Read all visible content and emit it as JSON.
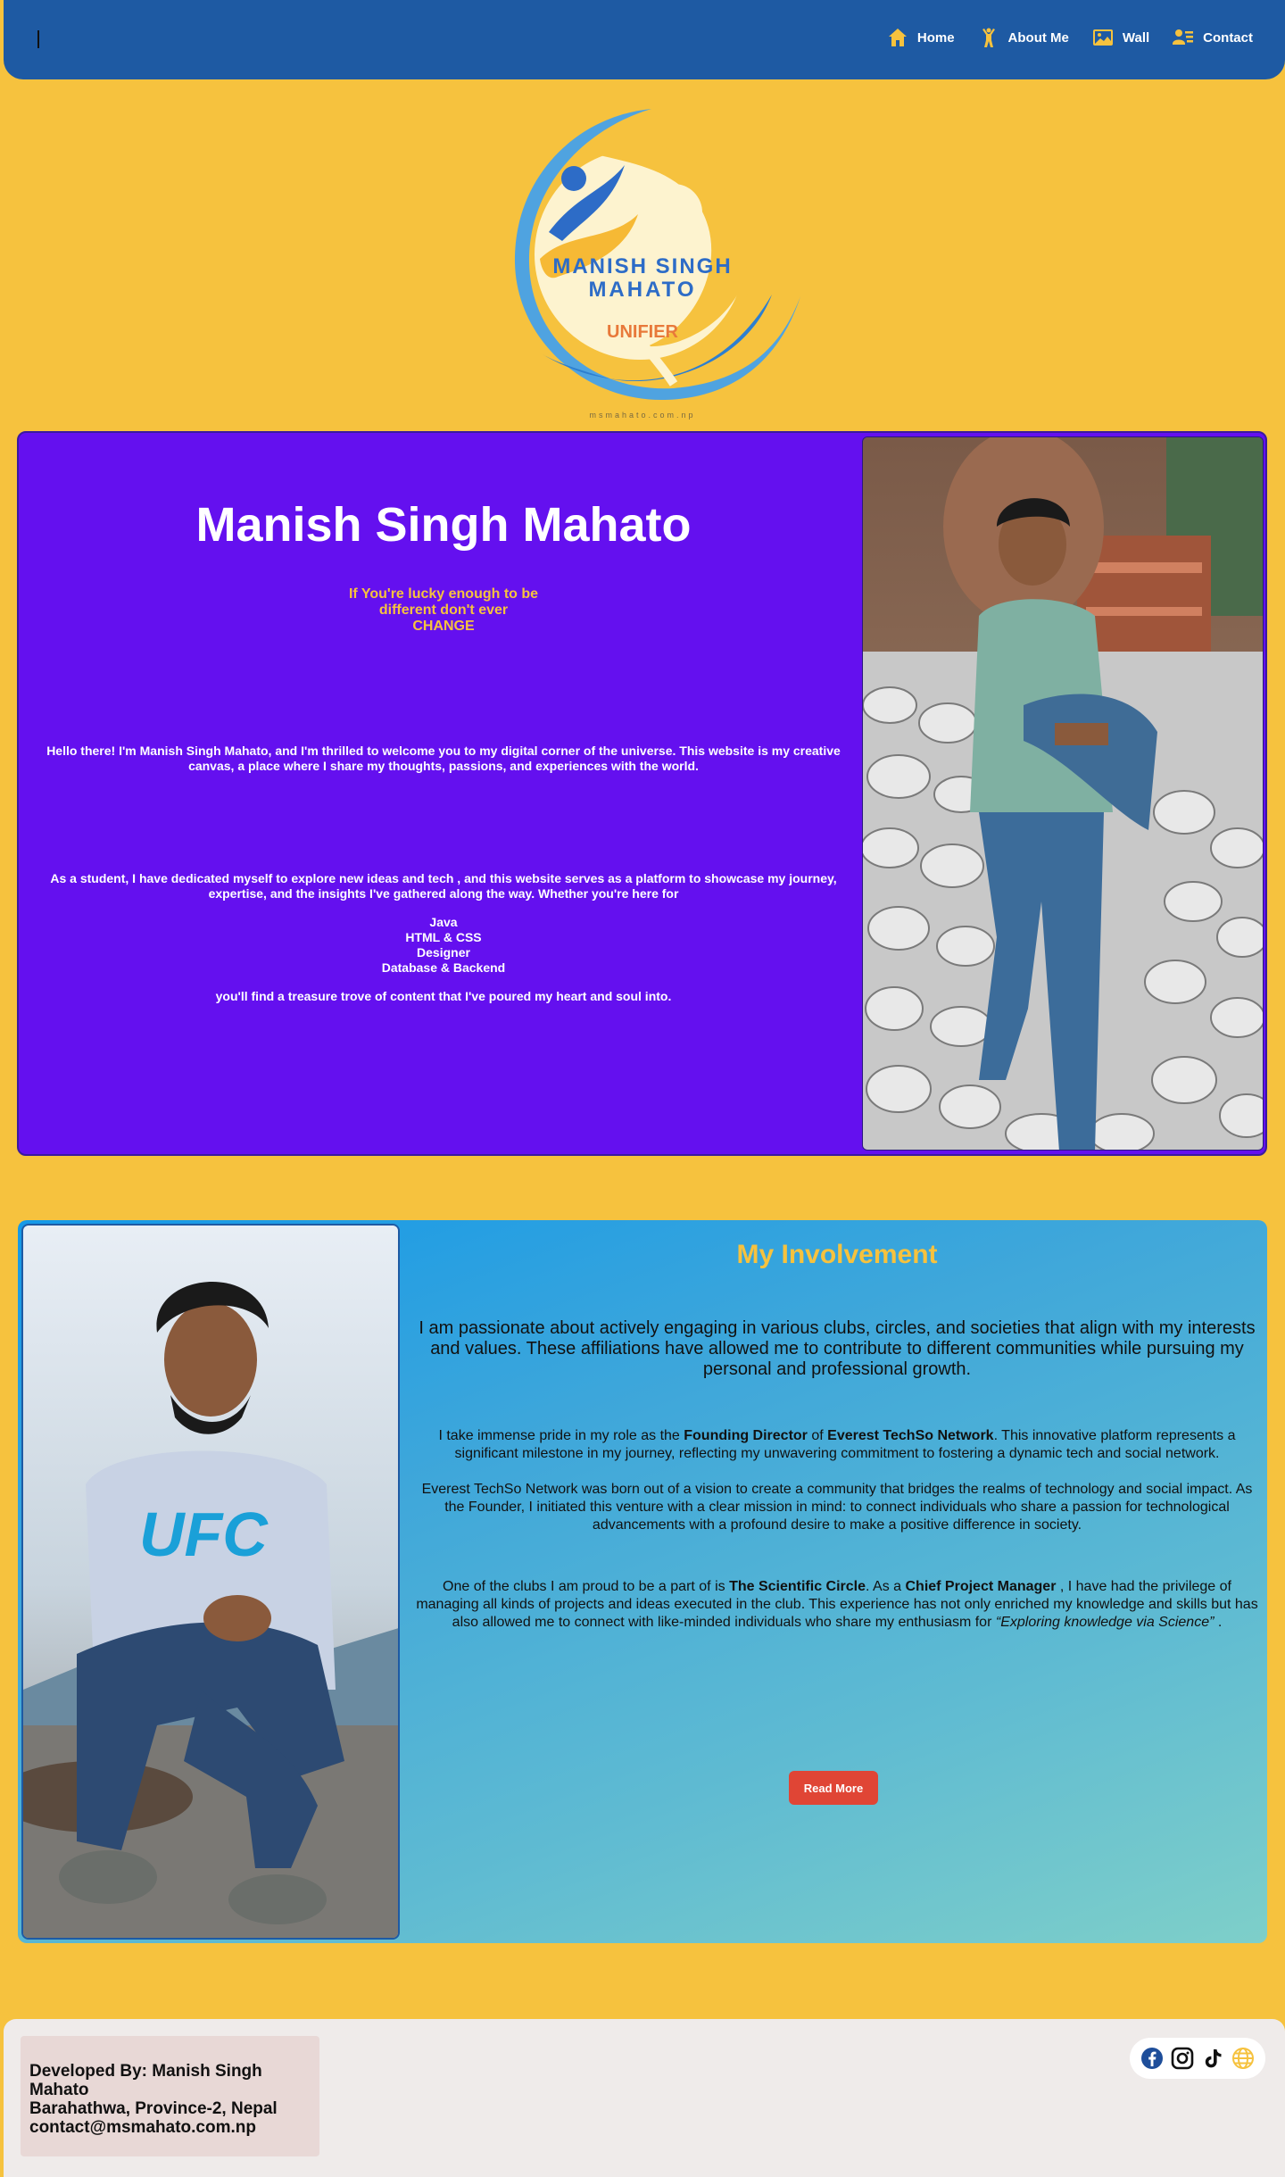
{
  "nav": {
    "items": [
      {
        "label": "Home",
        "icon": "home-icon"
      },
      {
        "label": "About Me",
        "icon": "person-icon"
      },
      {
        "label": "Wall",
        "icon": "image-icon"
      },
      {
        "label": "Contact",
        "icon": "contact-card-icon"
      }
    ]
  },
  "logo": {
    "line1": "MANISH SINGH",
    "line2": "MAHATO",
    "tagline": "UNIFIER",
    "url": "msmahato.com.np"
  },
  "hero": {
    "title": "Manish Singh Mahato",
    "quote_lines": [
      "If You're lucky enough to be",
      "different don't ever",
      "CHANGE"
    ],
    "intro": "Hello there! I'm Manish Singh Mahato, and I'm thrilled to welcome you to my digital corner of the universe. This website is my creative canvas, a place where I share my thoughts, passions, and experiences with the world.",
    "student": "As a student, I have dedicated myself to explore new ideas and tech , and this website serves as a platform to showcase my journey, expertise, and the insights I've gathered along the way. Whether you're here for",
    "skills": [
      "Java",
      "HTML & CSS",
      "Designer",
      "Database & Backend"
    ],
    "closing": "you'll find a treasure trove of content that I've poured my heart and soul into."
  },
  "involvement": {
    "title": "My Involvement",
    "lead": "I am passionate about actively engaging in various clubs, circles, and societies that align with my interests and values. These affiliations have allowed me to contribute to different communities while pursuing my personal and professional growth.",
    "p1_pre": "I take immense pride in my role as the ",
    "p1_role": "Founding Director",
    "p1_of": " of ",
    "p1_org": "Everest TechSo Network",
    "p1_post": ". This innovative platform represents a significant milestone in my journey, reflecting my unwavering commitment to fostering a dynamic tech and social network.",
    "p2": "Everest TechSo Network was born out of a vision to create a community that bridges the realms of technology and social impact. As the Founder, I initiated this venture with a clear mission in mind: to connect individuals who share a passion for technological advancements with a profound desire to make a positive difference in society.",
    "p3_pre": "One of the clubs I am proud to be a part of is ",
    "p3_club": "The Scientific Circle",
    "p3_as": ". As a ",
    "p3_role": "Chief Project Manager",
    "p3_post": " , I have had the privilege of managing all kinds of projects and ideas executed in the club. This experience has not only enriched my knowledge and skills but has also allowed me to connect with like-minded individuals who share my enthusiasm for ",
    "p3_motto": "“Exploring knowledge via Science”",
    "p3_end": " .",
    "button": "Read More"
  },
  "footer": {
    "developer": "Developed By: Manish Singh Mahato",
    "address": "Barahathwa, Province-2, Nepal",
    "email": "contact@msmahato.com.np",
    "socials": [
      "facebook-icon",
      "instagram-icon",
      "tiktok-icon",
      "globe-icon"
    ]
  },
  "colors": {
    "page_bg": "#f6c23e",
    "nav_bg": "#1e5aa3",
    "hero_bg": "#6410ef",
    "accent_yellow": "#f6c23e",
    "button_red": "#e04535"
  }
}
